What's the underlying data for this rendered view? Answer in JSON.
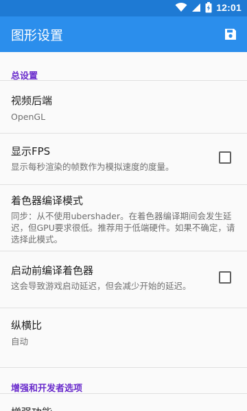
{
  "status_bar": {
    "time": "12:01",
    "icons": [
      "wifi-icon",
      "signal-icon",
      "battery-charging-icon"
    ],
    "color": "#1e7ad4"
  },
  "app_bar": {
    "title": "图形设置",
    "color": "#2b8eec",
    "action_icon": "save-icon"
  },
  "sections": {
    "general": "总设置",
    "enhancements": "增强和开发者选项"
  },
  "prefs": {
    "backend": {
      "title": "视频后端",
      "summary": "OpenGL"
    },
    "fps": {
      "title": "显示FPS",
      "summary": "显示每秒渲染的帧数作为模拟速度的度量。",
      "checked": false
    },
    "shader_mode": {
      "title": "着色器编译模式",
      "summary": "同步：从不使用ubershader。在着色器编译期间会发生延迟，但GPU要求很低。推荐用于低端硬件。如果不确定，请选择此模式。"
    },
    "precompile": {
      "title": "启动前编译着色器",
      "summary": "这会导致游戏启动延迟，但会减少开始的延迟。",
      "checked": false
    },
    "aspect": {
      "title": "纵横比",
      "summary": "自动"
    },
    "enhancements_partial": {
      "title": "增强功能"
    }
  },
  "accent_color": "#6a2ccc"
}
